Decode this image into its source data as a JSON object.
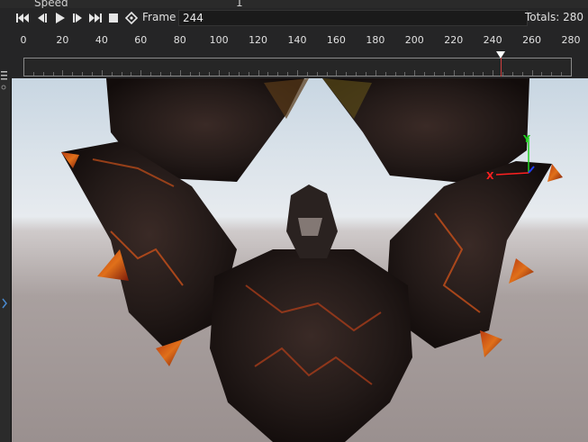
{
  "speed": {
    "label": "Speed",
    "value": "1"
  },
  "toolbar": {
    "frame_label": "Frame",
    "frame_value": "244",
    "totals_text": "Totals: 280"
  },
  "timeline": {
    "tick_labels": [
      "0",
      "20",
      "40",
      "60",
      "80",
      "100",
      "120",
      "140",
      "160",
      "180",
      "200",
      "220",
      "240",
      "260",
      "280"
    ],
    "current_frame": 244,
    "total_frames": 280
  },
  "gizmo": {
    "x_label": "X",
    "y_label": "Y"
  },
  "colors": {
    "x_axis": "#ff2020",
    "y_axis": "#20d020",
    "z_axis": "#2040ff",
    "playhead": "#d04040"
  }
}
